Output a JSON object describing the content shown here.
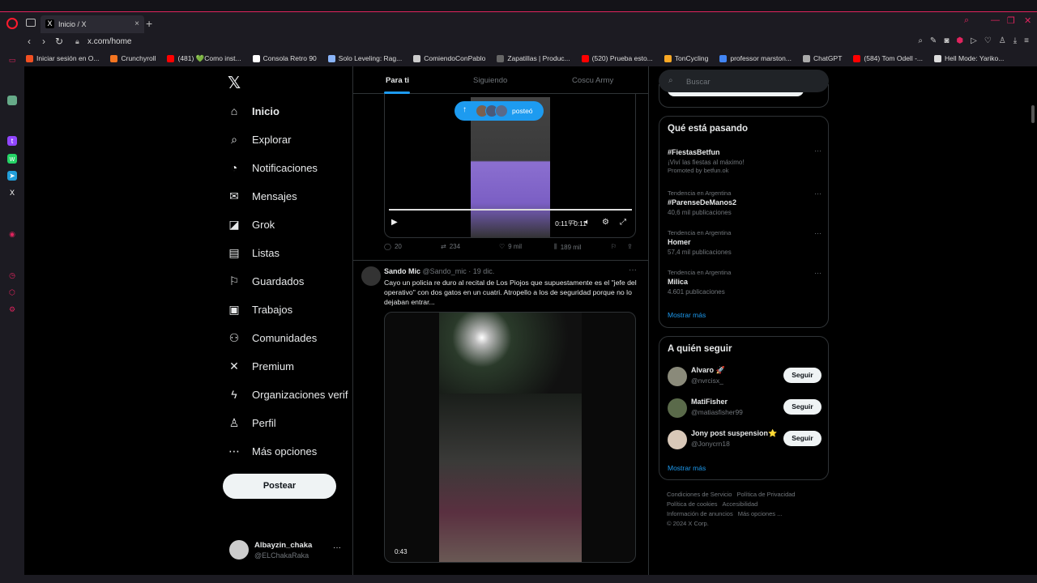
{
  "browser": {
    "tab_title": "Inicio / X",
    "url": "x.com/home",
    "bookmarks": [
      {
        "label": "Iniciar sesión en O...",
        "color": "#f25022"
      },
      {
        "label": "Crunchyroll",
        "color": "#f47521"
      },
      {
        "label": "(481) 💚Como inst...",
        "color": "#ff0000"
      },
      {
        "label": "Consola Retro 90",
        "color": "#ffffff"
      },
      {
        "label": "Solo Leveling: Rag...",
        "color": "#8ab4f8"
      },
      {
        "label": "ComiendoConPablo",
        "color": "#cccccc"
      },
      {
        "label": "Zapatillas | Produc...",
        "color": "#666666"
      },
      {
        "label": "(520) Prueba esto...",
        "color": "#ff0000"
      },
      {
        "label": "TonCycling",
        "color": "#f9a825"
      },
      {
        "label": "professor marston...",
        "color": "#4285f4"
      },
      {
        "label": "ChatGPT",
        "color": "#aaaaaa"
      },
      {
        "label": "(584) Tom Odell -...",
        "color": "#ff0000"
      },
      {
        "label": "Hell Mode: Yariko...",
        "color": "#dddddd"
      }
    ]
  },
  "nav": {
    "items": [
      {
        "label": "Inicio",
        "icon": "home-icon",
        "glyph": "⌂"
      },
      {
        "label": "Explorar",
        "icon": "search-icon",
        "glyph": "⌕"
      },
      {
        "label": "Notificaciones",
        "icon": "bell-icon",
        "glyph": "◔"
      },
      {
        "label": "Mensajes",
        "icon": "envelope-icon",
        "glyph": "✉"
      },
      {
        "label": "Grok",
        "icon": "grok-icon",
        "glyph": "◪"
      },
      {
        "label": "Listas",
        "icon": "list-icon",
        "glyph": "▤"
      },
      {
        "label": "Guardados",
        "icon": "bookmark-icon",
        "glyph": "⚐"
      },
      {
        "label": "Trabajos",
        "icon": "briefcase-icon",
        "glyph": "▣"
      },
      {
        "label": "Comunidades",
        "icon": "people-icon",
        "glyph": "⚇"
      },
      {
        "label": "Premium",
        "icon": "x-icon",
        "glyph": "✕"
      },
      {
        "label": "Organizaciones verif",
        "icon": "lightning-icon",
        "glyph": "ϟ"
      },
      {
        "label": "Perfil",
        "icon": "person-icon",
        "glyph": "♙"
      },
      {
        "label": "Más opciones",
        "icon": "more-icon",
        "glyph": "⋯"
      }
    ],
    "post_label": "Postear",
    "profile": {
      "name": "Albayzin_chaka",
      "handle": "@ELChakaRaka"
    }
  },
  "feed": {
    "tabs": [
      "Para ti",
      "Siguiendo",
      "Coscu Army"
    ],
    "posted_pill": "posteó",
    "video1": {
      "time": "0:11 / 0:11"
    },
    "tweet1_actions": {
      "replies": "20",
      "reposts": "234",
      "likes": "9 mil",
      "views": "189 mil"
    },
    "tweet2": {
      "name": "Sando Mic",
      "handle": "@Sando_mic · 19 dic.",
      "text": "Cayo un policia re duro al recital de Los Piojos que supuestamente es el \"jefe del operativo\" con dos gatos en un cuatri. Atropello a los de seguridad porque no lo dejaban entrar...",
      "video_time": "0:43"
    }
  },
  "right": {
    "search_placeholder": "Buscar",
    "trends_title": "Qué está pasando",
    "trends": [
      {
        "meta": "",
        "title": "#FiestasBetfun",
        "sub": "¡Viví las fiestas al máximo!",
        "sub2": "Promoted by betfun.ok"
      },
      {
        "meta": "Tendencia en Argentina",
        "title": "#ParenseDeManos2",
        "sub": "40,6 mil publicaciones",
        "sub2": ""
      },
      {
        "meta": "Tendencia en Argentina",
        "title": "Homer",
        "sub": "57,4 mil publicaciones",
        "sub2": ""
      },
      {
        "meta": "Tendencia en Argentina",
        "title": "Milica",
        "sub": "4.601 publicaciones",
        "sub2": ""
      }
    ],
    "show_more": "Mostrar más",
    "who_title": "A quién seguir",
    "who": [
      {
        "name": "Alvaro 🚀",
        "handle": "@nvrcisx_",
        "color": "#8a8a7a"
      },
      {
        "name": "MatiFisher",
        "handle": "@matiasfisher99",
        "color": "#5a6a4a"
      },
      {
        "name": "Jony post suspension⭐",
        "handle": "@Jonycrn18",
        "color": "#d8c8b8"
      }
    ],
    "follow_label": "Seguir",
    "footer": [
      "Condiciones de Servicio",
      "Política de Privacidad",
      "Política de cookies",
      "Accesibilidad",
      "Información de anuncios",
      "Más opciones ...",
      "© 2024 X Corp."
    ]
  }
}
